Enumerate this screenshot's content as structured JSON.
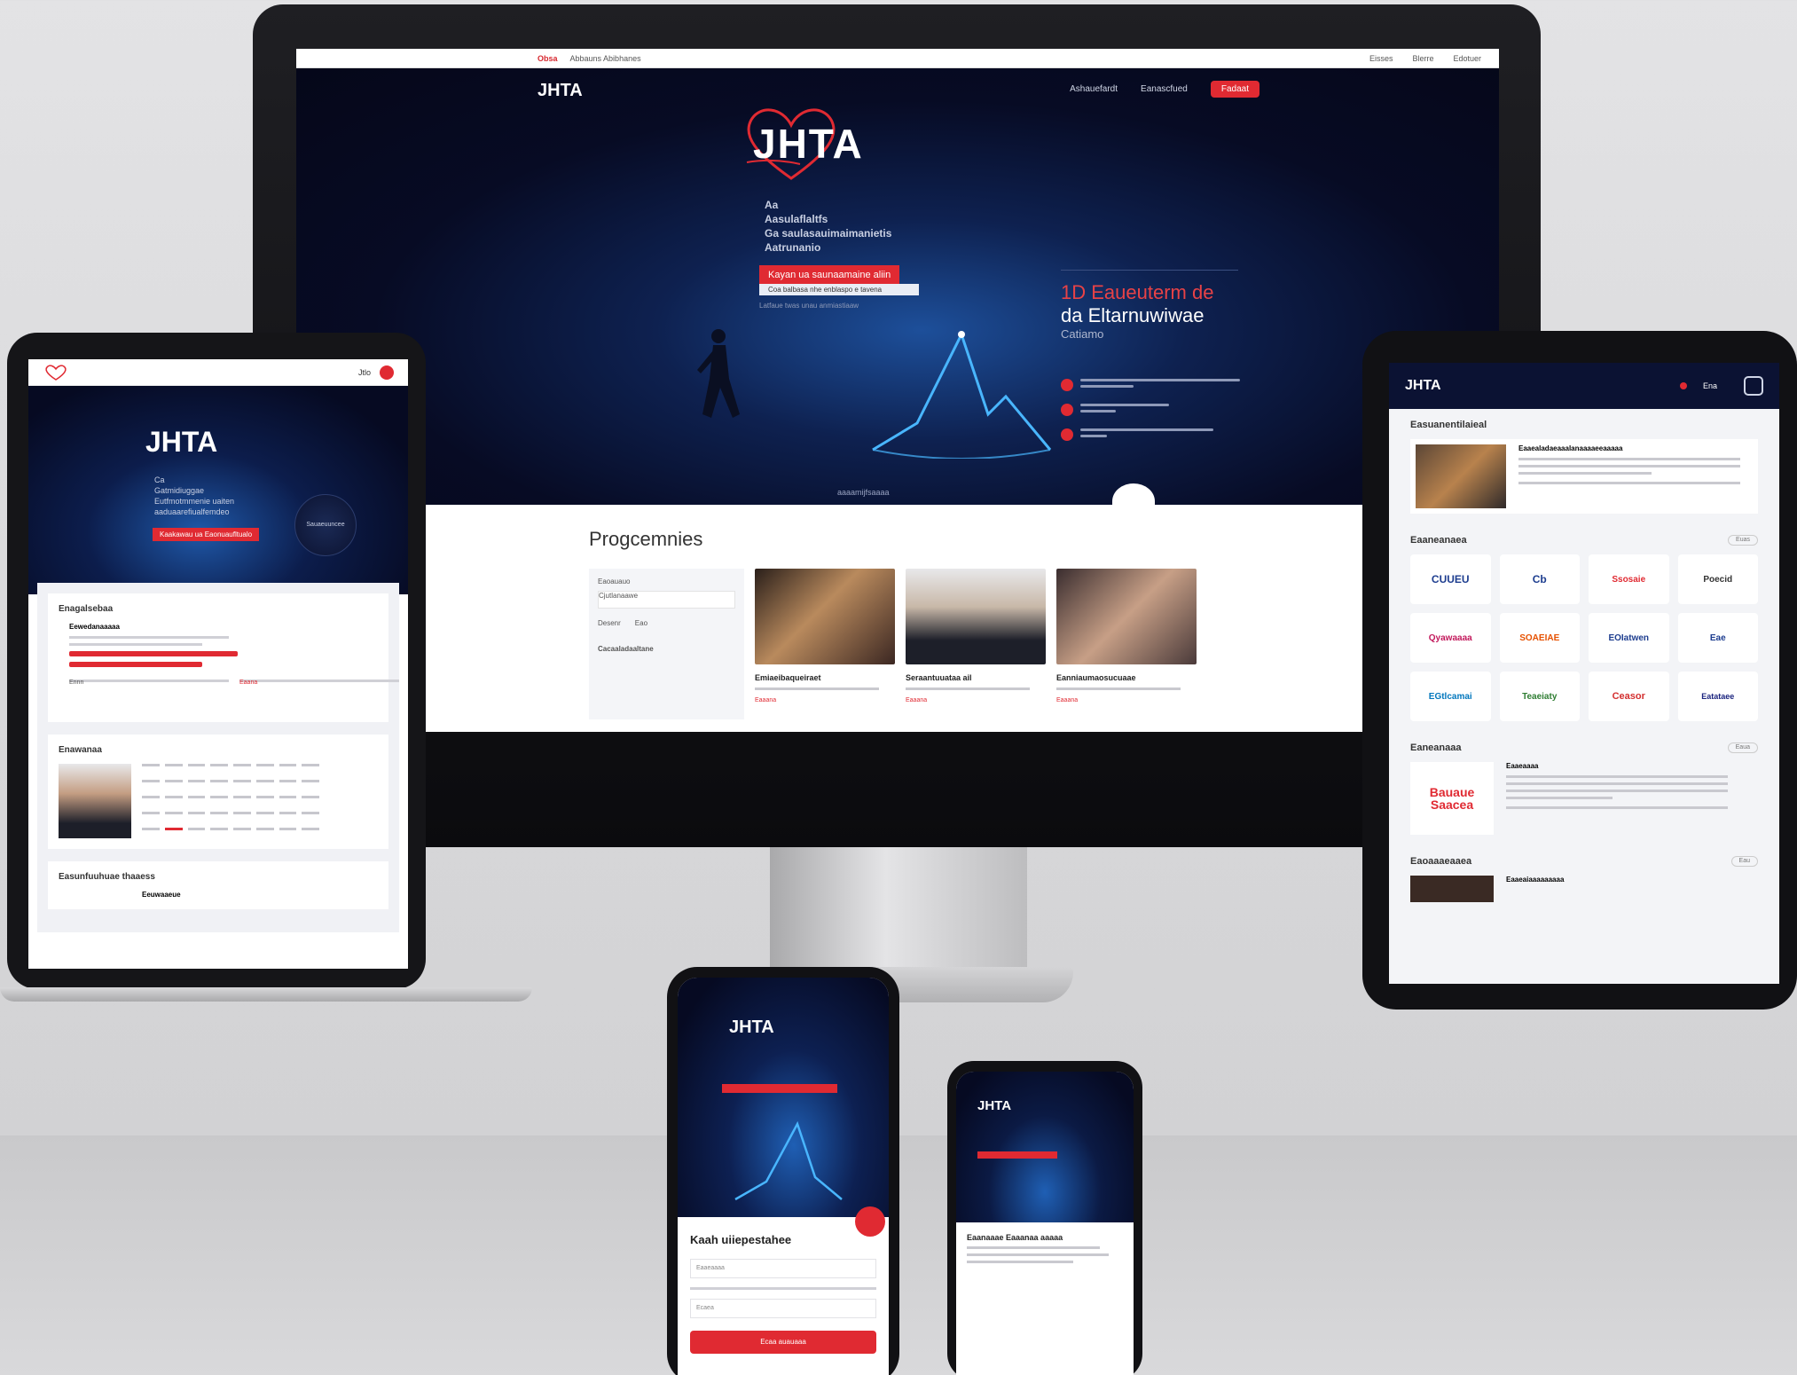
{
  "desktop": {
    "topbar": {
      "brand": "Obsa",
      "breadcrumb": "Abbauns Abibhanes",
      "links": [
        "Eisses",
        "Blerre",
        "Edotuer"
      ]
    },
    "hero": {
      "logo_small": "JHTA",
      "nav": [
        "Ashauefardt",
        "Eanascfued"
      ],
      "nav_cta": "Fadaat",
      "title": "JHTA",
      "subtitle": [
        "Aa",
        "Aasulaflaltfs",
        "Ga saulasauimaimanietis",
        "Aatrunanio"
      ],
      "banner": "Kayan ua saunaamaine aliin",
      "banner_sub": "Coa balbasa nhe enblaspo e tavena",
      "small_caption": "Latfaue twas unau anmiastiaaw",
      "right_title_red": "1D Eaueuterm de",
      "right_title_white": "da Eltarnuwiwae",
      "right_sub": "Catiamo",
      "bottom_label": "aaaamijfsaaaa"
    },
    "programmes": {
      "title": "Progcemnies",
      "filter": {
        "label": "Eaoauauo",
        "option": "Cjutlanaawe",
        "price_a": "Desenr",
        "price_b": "Eao",
        "footer": "Cacaaladaaltane"
      },
      "cards": [
        {
          "name": "Emiaeibaqueiraet",
          "link": "Eaaana"
        },
        {
          "name": "Seraantuuataa ail",
          "link": "Eaaana"
        },
        {
          "name": "Eanniaumaosucuaae",
          "link": "Eaaana"
        }
      ]
    }
  },
  "tablet_left": {
    "bar_label": "Jtlo",
    "title": "JHTA",
    "subtitle": [
      "Ca",
      "Gatmidiuggae",
      "Eutfmotmmenie uaiten",
      "aaduaarefiualfemdeo"
    ],
    "banner": "Kaakawau ua Eaonuaufltualo",
    "circle_label": "Sauaeuuncee",
    "sections": [
      {
        "title": "Enagalsebaa",
        "item": "Eewedanaaaaa",
        "price": "Ennn",
        "meta": "Eaana"
      },
      {
        "title": "Enawanaa"
      },
      {
        "title": "Easunfuuhuae thaaess",
        "item": "Eeuwaaeue"
      }
    ]
  },
  "tablet_right": {
    "logo": "JHTA",
    "bar_label": "Ena",
    "news_title": "Easuanentilaieal",
    "news_item": "Eaaealadaeaaalanaaaaeeaaaaa",
    "partners_title": "Eaaneanaea",
    "partners_pill": "Euas",
    "logos": [
      "CUUEU",
      "Cb",
      "Ssosaie",
      "Poecid",
      "Qyawaaaa",
      "SOAEIAE",
      "EOIatwen",
      "Eae",
      "EGtlcamai",
      "Teaeiaty",
      "Ceasor",
      "Eatataee"
    ],
    "events_title": "Eaneanaaa",
    "events_pill": "Eaua",
    "event_item": "Eaaeaaaa",
    "event_badge": "Bauaue Saacea",
    "docs_title": "Eaoaaaeaaea",
    "docs_pill": "Eau",
    "docs_item": "Eaaeaiaaaaaaaaa"
  },
  "phone_main": {
    "title": "JHTA",
    "form_title": "Kaah uiiepestahee",
    "field_1": "Eaaeaaaa",
    "field_2": "Ecaea",
    "submit": "Ecaa auauaaa"
  },
  "phone_small": {
    "title": "JHTA",
    "heading": "Eaanaaae Eaaanaa aaaaa"
  }
}
